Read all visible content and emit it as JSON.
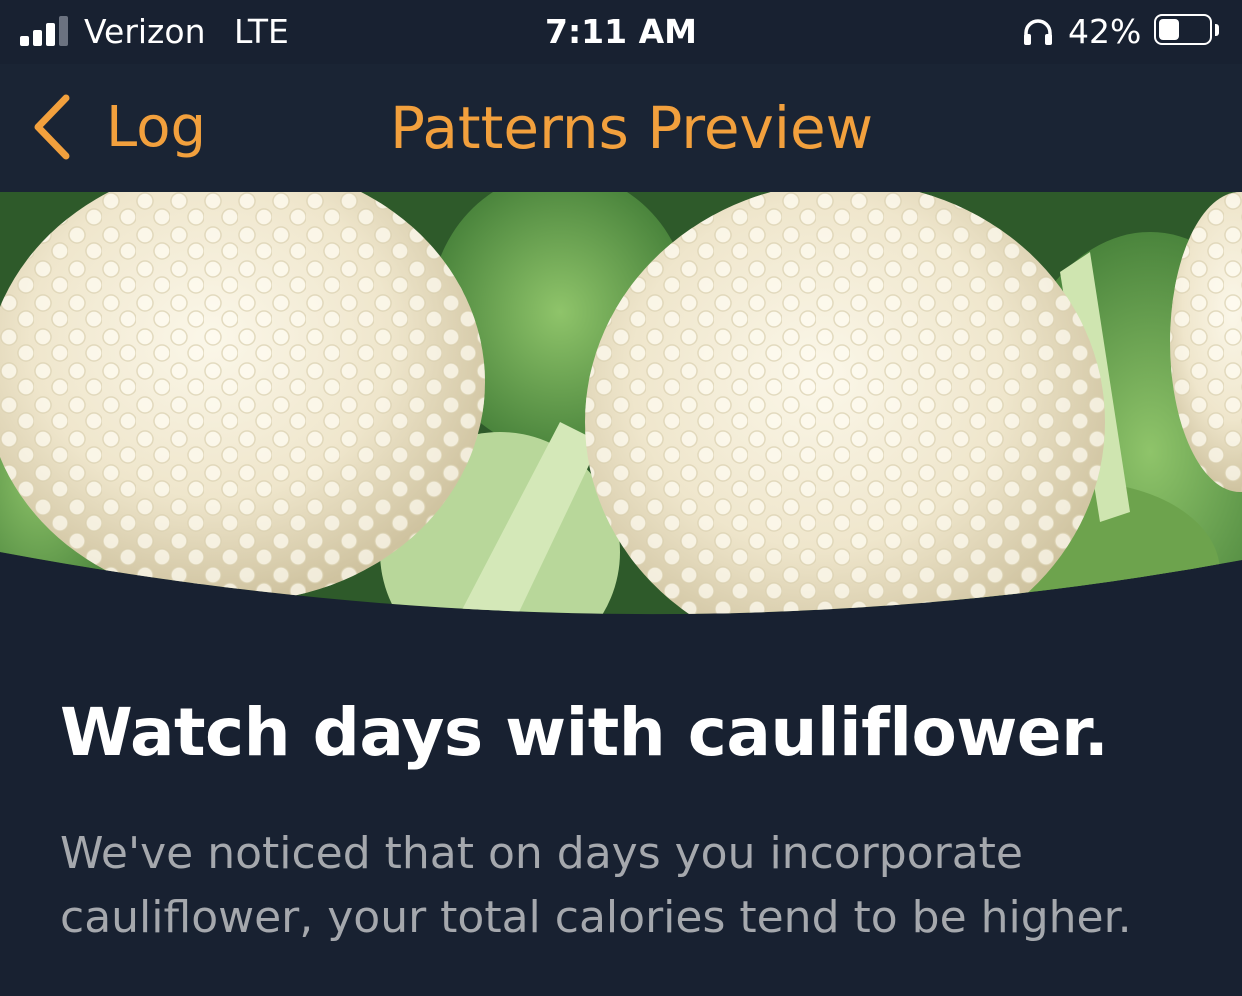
{
  "status_bar": {
    "carrier": "Verizon",
    "network": "LTE",
    "time": "7:11 AM",
    "battery_percent": "42%",
    "battery_level": 0.42,
    "icons": [
      "signal-icon",
      "headphones-icon",
      "battery-icon"
    ]
  },
  "nav": {
    "back_label": "Log",
    "title": "Patterns Preview",
    "accent_color": "#f2a03d",
    "back_icon": "chevron-left-icon"
  },
  "hero": {
    "subject": "cauliflower-photo"
  },
  "content": {
    "headline": "Watch days with cauliflower.",
    "body": "We've noticed that on days you incorporate cauliflower, your total calories tend to be higher."
  },
  "colors": {
    "background": "#182131",
    "headline": "#ffffff",
    "body": "#a5a8ad"
  }
}
